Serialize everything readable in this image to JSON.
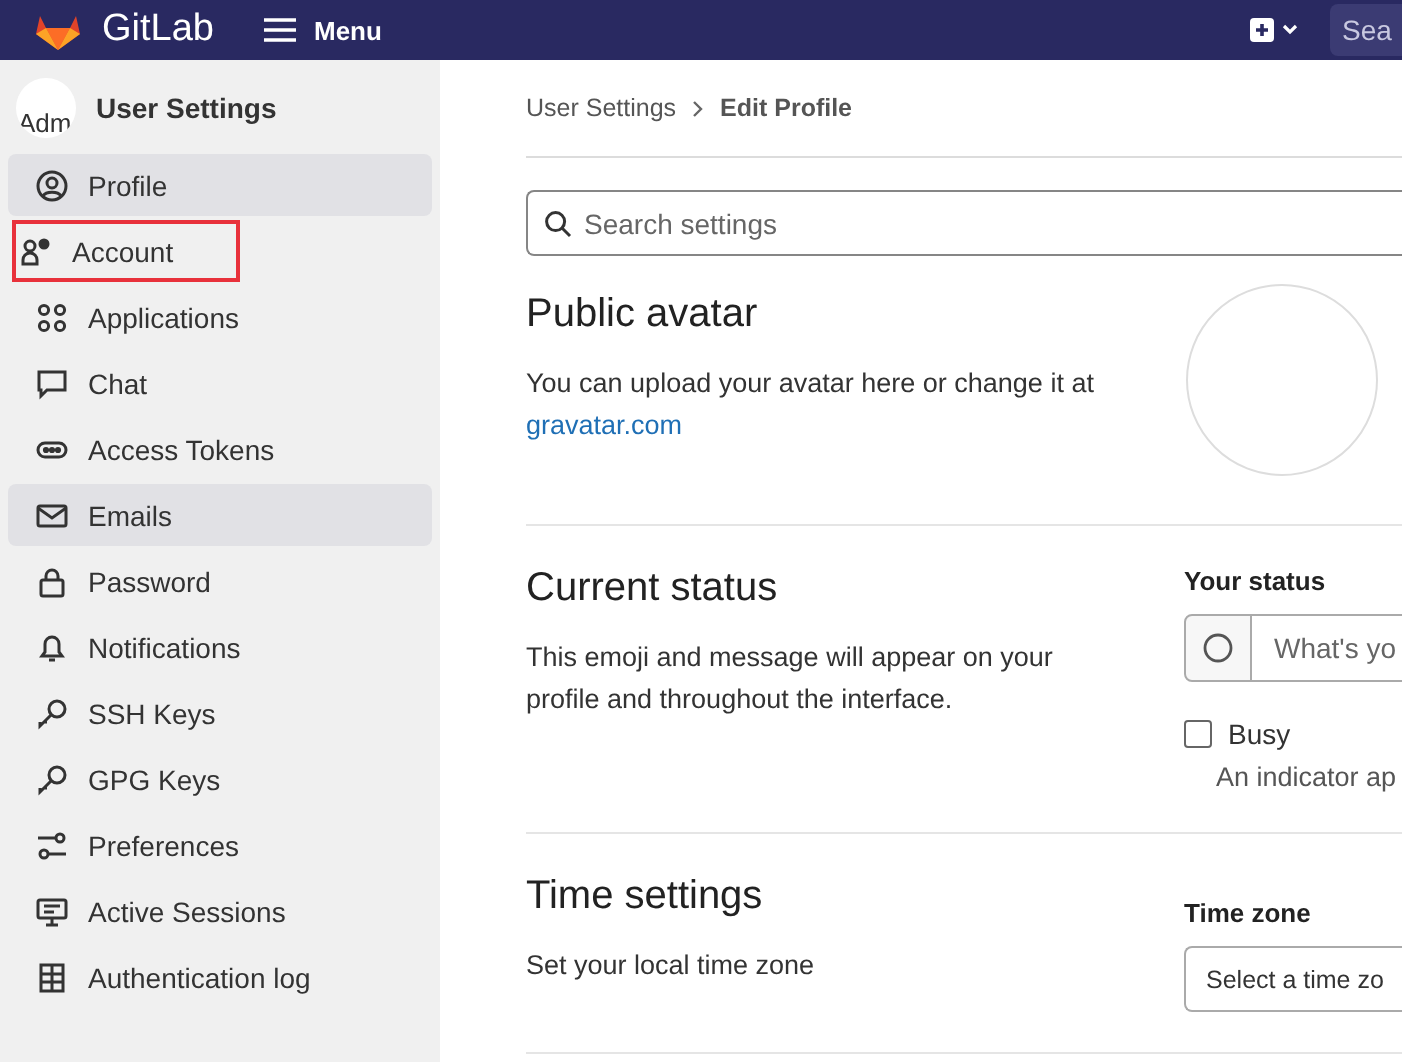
{
  "topbar": {
    "brand": "GitLab",
    "menu": "Menu",
    "search_placeholder": "Sea"
  },
  "sidebar": {
    "title": "User Settings",
    "avatar_alt": "Adm",
    "items": [
      {
        "label": "Profile",
        "selected": true,
        "highlighted": false
      },
      {
        "label": "Account",
        "selected": false,
        "highlighted": true
      },
      {
        "label": "Applications",
        "selected": false,
        "highlighted": false
      },
      {
        "label": "Chat",
        "selected": false,
        "highlighted": false
      },
      {
        "label": "Access Tokens",
        "selected": false,
        "highlighted": false
      },
      {
        "label": "Emails",
        "selected": true,
        "highlighted": false
      },
      {
        "label": "Password",
        "selected": false,
        "highlighted": false
      },
      {
        "label": "Notifications",
        "selected": false,
        "highlighted": false
      },
      {
        "label": "SSH Keys",
        "selected": false,
        "highlighted": false
      },
      {
        "label": "GPG Keys",
        "selected": false,
        "highlighted": false
      },
      {
        "label": "Preferences",
        "selected": false,
        "highlighted": false
      },
      {
        "label": "Active Sessions",
        "selected": false,
        "highlighted": false
      },
      {
        "label": "Authentication log",
        "selected": false,
        "highlighted": false
      }
    ]
  },
  "breadcrumb": [
    "User Settings",
    "Edit Profile"
  ],
  "search": {
    "placeholder": "Search settings"
  },
  "public_avatar": {
    "title": "Public avatar",
    "text": "You can upload your avatar here or change it at",
    "link": "gravatar.com"
  },
  "current_status": {
    "title": "Current status",
    "text": "This emoji and message will appear on your profile and throughout the interface.",
    "status_label": "Your status",
    "status_placeholder": "What's yo",
    "busy": {
      "label": "Busy",
      "checked": false
    },
    "busy_help": "An indicator ap"
  },
  "time_settings": {
    "title": "Time settings",
    "text": "Set your local time zone",
    "zone_label": "Time zone",
    "zone_value": "Select a time zo"
  }
}
